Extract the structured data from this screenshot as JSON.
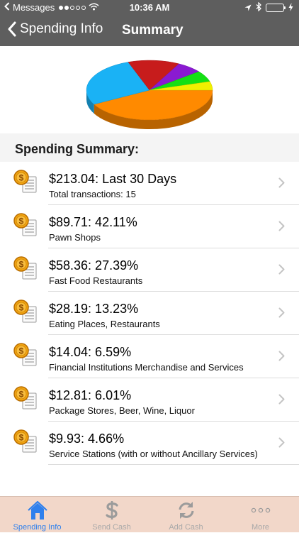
{
  "status_bar": {
    "back_app": "Messages",
    "time": "10:36 AM"
  },
  "nav": {
    "back_label": "Spending Info",
    "title": "Summary"
  },
  "chart_data": {
    "type": "pie",
    "title": "",
    "series": [
      {
        "label": "Pawn Shops",
        "value": 42.11,
        "color": "#ff8a00"
      },
      {
        "label": "Fast Food Restaurants",
        "value": 27.39,
        "color": "#1ab2f5"
      },
      {
        "label": "Eating Places, Restaurants",
        "value": 13.23,
        "color": "#c71c1c"
      },
      {
        "label": "Financial Institutions Merchandise and Services",
        "value": 6.59,
        "color": "#8a1ad1"
      },
      {
        "label": "Package Stores, Beer, Wine, Liquor",
        "value": 6.01,
        "color": "#14e014"
      },
      {
        "label": "Service Stations (with or without Ancillary Services)",
        "value": 4.66,
        "color": "#f0f000"
      }
    ]
  },
  "section": {
    "header": "Spending Summary:"
  },
  "items": [
    {
      "title": "$213.04: Last 30 Days",
      "subtitle": "Total transactions: 15"
    },
    {
      "title": "$89.71: 42.11%",
      "subtitle": "Pawn Shops"
    },
    {
      "title": "$58.36: 27.39%",
      "subtitle": "Fast Food Restaurants"
    },
    {
      "title": "$28.19: 13.23%",
      "subtitle": "Eating Places, Restaurants"
    },
    {
      "title": "$14.04: 6.59%",
      "subtitle": "Financial Institutions Merchandise and Services"
    },
    {
      "title": "$12.81: 6.01%",
      "subtitle": "Package Stores, Beer, Wine, Liquor"
    },
    {
      "title": "$9.93: 4.66%",
      "subtitle": "Service Stations (with or without Ancillary Services)"
    }
  ],
  "tabs": [
    {
      "label": "Spending Info",
      "icon": "home-icon",
      "active": true
    },
    {
      "label": "Send Cash",
      "icon": "dollar-icon",
      "active": false
    },
    {
      "label": "Add Cash",
      "icon": "refresh-icon",
      "active": false
    },
    {
      "label": "More",
      "icon": "more-icon",
      "active": false
    }
  ],
  "colors": {
    "nav_bg": "#5e5e5e",
    "tab_bar_bg": "#f2d7c9",
    "accent": "#2f80ed"
  }
}
